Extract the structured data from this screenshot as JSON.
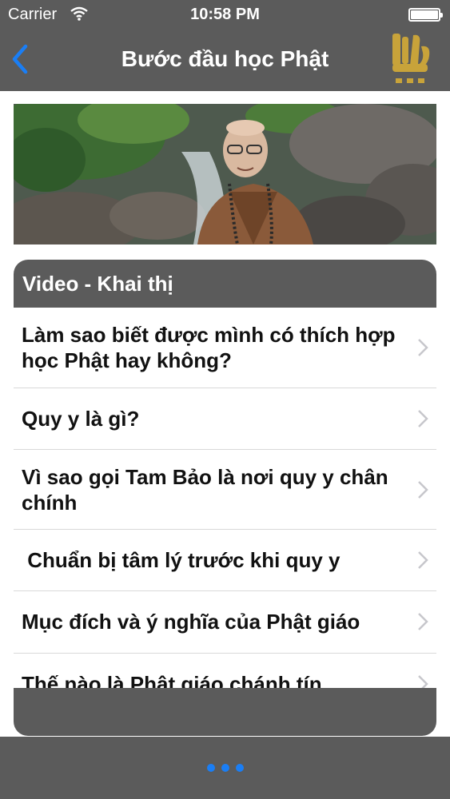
{
  "status_bar": {
    "carrier": "Carrier",
    "time": "10:58 PM"
  },
  "nav": {
    "title": "Bước đầu học Phật",
    "back_icon": "chevron-left-icon",
    "logo": "dharma-drum-mountain-logo",
    "accent_color": "#1a7ef5",
    "logo_color": "#c8a33a"
  },
  "hero": {
    "description_icon": "monk-photo"
  },
  "section": {
    "title": "Video - Khai thị",
    "items": [
      {
        "label": "Làm sao biết được mình có thích hợp học Phật hay không?"
      },
      {
        "label": "Quy y là gì?"
      },
      {
        "label": "Vì sao gọi Tam Bảo là nơi quy y chân chính"
      },
      {
        "label": " Chuẩn bị tâm lý trước khi quy y"
      },
      {
        "label": "Mục đích và ý nghĩa của Phật giáo"
      },
      {
        "label": "Thế nào là Phật giáo chánh tín"
      }
    ]
  },
  "bottom_bar": {
    "more_icon": "more-dots-icon",
    "dot_color": "#1a7ef5"
  }
}
